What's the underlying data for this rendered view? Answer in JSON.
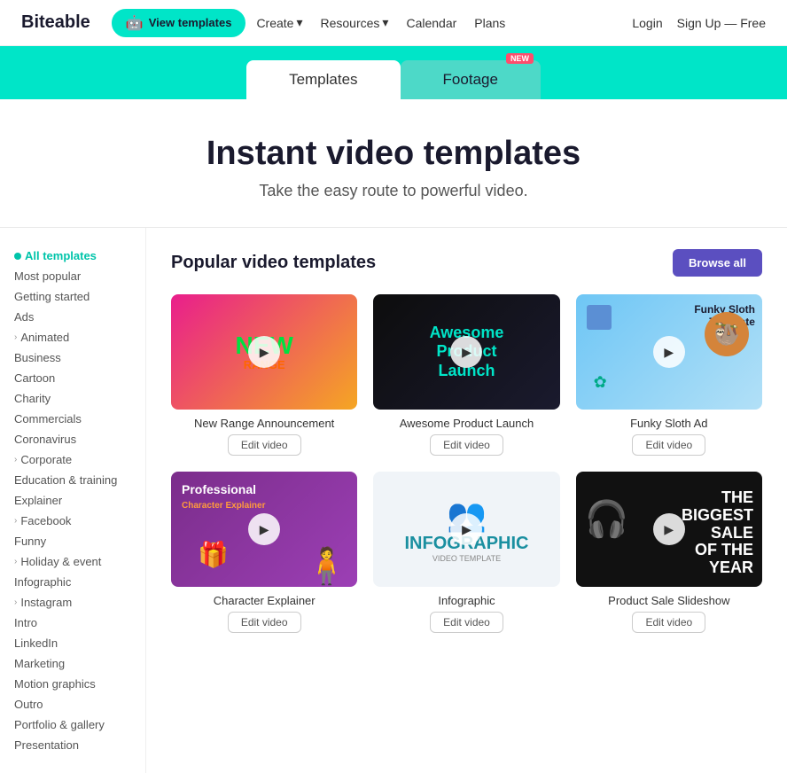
{
  "brand": {
    "name": "Biteable"
  },
  "nav": {
    "view_templates_label": "View templates",
    "menu": [
      {
        "label": "Create",
        "has_dropdown": true
      },
      {
        "label": "Resources",
        "has_dropdown": true
      },
      {
        "label": "Calendar",
        "has_dropdown": false
      },
      {
        "label": "Plans",
        "has_dropdown": false
      }
    ],
    "login_label": "Login",
    "signup_label": "Sign Up — Free"
  },
  "tabs": [
    {
      "label": "Templates",
      "active": true,
      "is_new": false
    },
    {
      "label": "Footage",
      "active": false,
      "is_new": true
    }
  ],
  "hero": {
    "title": "Instant video templates",
    "subtitle": "Take the easy route to powerful video."
  },
  "sidebar": {
    "items": [
      {
        "label": "All templates",
        "active": true,
        "has_dot": true
      },
      {
        "label": "Most popular",
        "active": false
      },
      {
        "label": "Getting started",
        "active": false
      },
      {
        "label": "Ads",
        "active": false
      },
      {
        "label": "Animated",
        "active": false,
        "has_arrow": true
      },
      {
        "label": "Business",
        "active": false
      },
      {
        "label": "Cartoon",
        "active": false
      },
      {
        "label": "Charity",
        "active": false
      },
      {
        "label": "Commercials",
        "active": false
      },
      {
        "label": "Coronavirus",
        "active": false
      },
      {
        "label": "Corporate",
        "active": false,
        "has_arrow": true
      },
      {
        "label": "Education & training",
        "active": false
      },
      {
        "label": "Explainer",
        "active": false
      },
      {
        "label": "Facebook",
        "active": false,
        "has_arrow": true
      },
      {
        "label": "Funny",
        "active": false
      },
      {
        "label": "Holiday & event",
        "active": false,
        "has_arrow": true
      },
      {
        "label": "Infographic",
        "active": false
      },
      {
        "label": "Instagram",
        "active": false,
        "has_arrow": true
      },
      {
        "label": "Intro",
        "active": false
      },
      {
        "label": "LinkedIn",
        "active": false
      },
      {
        "label": "Marketing",
        "active": false
      },
      {
        "label": "Motion graphics",
        "active": false
      },
      {
        "label": "Outro",
        "active": false
      },
      {
        "label": "Portfolio & gallery",
        "active": false
      },
      {
        "label": "Presentation",
        "active": false
      }
    ]
  },
  "content": {
    "section_title": "Popular video templates",
    "browse_all_label": "Browse all",
    "videos": [
      {
        "title": "New Range Announcement",
        "edit_label": "Edit video",
        "thumb_type": "new-range",
        "top_text": "NEW",
        "bottom_text": "RANGE",
        "sub_text": ""
      },
      {
        "title": "Awesome Product Launch",
        "edit_label": "Edit video",
        "thumb_type": "product-launch",
        "top_text": "Awesome",
        "bottom_text": "Product Launch",
        "sub_text": ""
      },
      {
        "title": "Funky Sloth Ad",
        "edit_label": "Edit video",
        "thumb_type": "funky-sloth",
        "top_text": "Funky Sloth Template",
        "bottom_text": "",
        "sub_text": ""
      },
      {
        "title": "Character Explainer",
        "edit_label": "Edit video",
        "thumb_type": "character",
        "top_text": "Professional",
        "bottom_text": "",
        "sub_text": "Character Explainer"
      },
      {
        "title": "Infographic",
        "edit_label": "Edit video",
        "thumb_type": "infographic",
        "top_text": "INFOGRAPHIC",
        "bottom_text": "VIDEO TEMPLATE",
        "sub_text": ""
      },
      {
        "title": "Product Sale Slideshow",
        "edit_label": "Edit video",
        "thumb_type": "product-sale",
        "top_text": "THE BIGGEST SALE OF THE YEAR",
        "bottom_text": "",
        "sub_text": ""
      }
    ]
  }
}
